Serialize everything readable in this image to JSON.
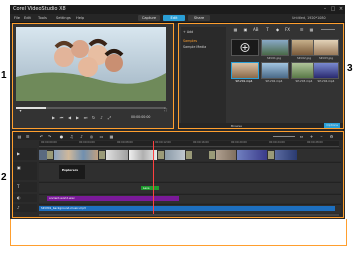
{
  "app": {
    "title": "Corel VideoStudio X8",
    "menu": [
      "File",
      "Edit",
      "Tools",
      "Settings",
      "Help"
    ],
    "tabs": [
      {
        "label": "Capture",
        "active": false
      },
      {
        "label": "Edit",
        "active": true
      },
      {
        "label": "Share",
        "active": false
      }
    ],
    "project_info": "Untitled, 1920*1080",
    "accent": "#2a9fd6"
  },
  "callouts": [
    "1",
    "2",
    "3"
  ],
  "player": {
    "timecode": "00:00:00:00",
    "progress": 0.2
  },
  "library": {
    "add_label": "Add",
    "folders": [
      "Samples",
      "Sample Media"
    ],
    "thumbnails": [
      {
        "label": "",
        "selected": false
      },
      {
        "label": "SP-I01.jpg",
        "selected": false
      },
      {
        "label": "SP-I02.jpg",
        "selected": false
      },
      {
        "label": "SP-I03.jpg",
        "selected": false
      },
      {
        "label": "SP-V01.mp4",
        "selected": true
      },
      {
        "label": "SP-V02.mp4",
        "selected": false
      },
      {
        "label": "SP-V03.mp4",
        "selected": false
      },
      {
        "label": "SP-V04.mp4",
        "selected": false
      }
    ],
    "browse_label": "Browse",
    "options_label": "Options"
  },
  "timeline": {
    "ruler": [
      "00:00:00:00",
      "00:00:04:00",
      "00:00:08:00",
      "00:00:12:00",
      "00:00:16:00",
      "00:00:20:00",
      "00:00:24:00",
      "00:00:28:00"
    ],
    "title_clip": "Explorers",
    "fx_clip": "Lens",
    "music_clip": "ancient-world.wav",
    "audio_clip": "SP-M01_background-music.mp3"
  }
}
